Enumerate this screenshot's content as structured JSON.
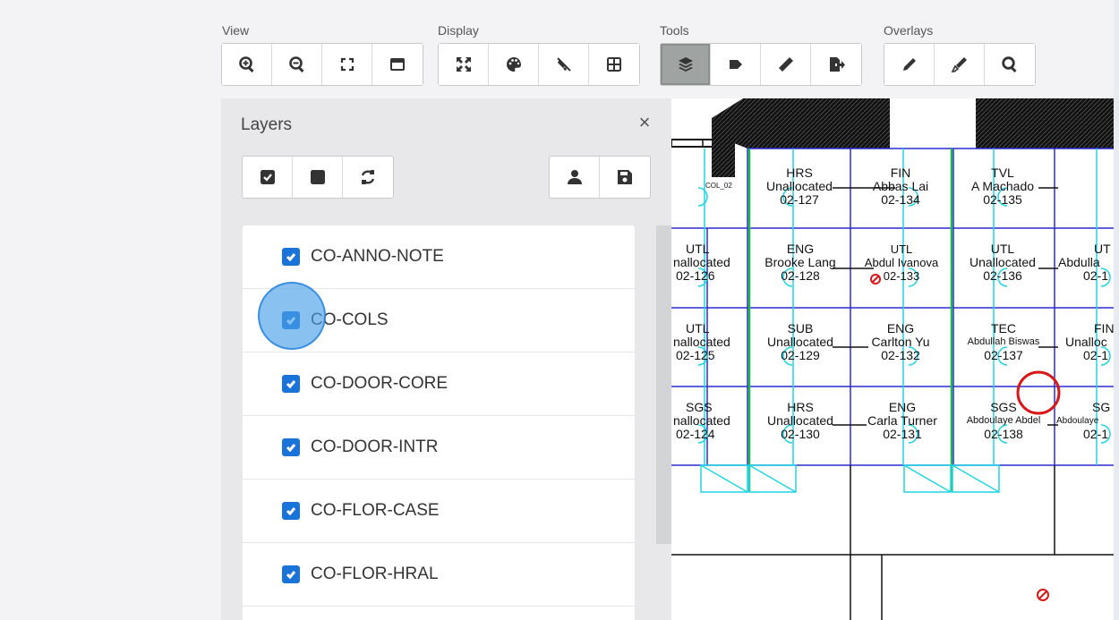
{
  "toolbar": {
    "groups": [
      {
        "label": "View",
        "buttons": [
          "zoom-in-icon",
          "zoom-out-icon",
          "fit-screen-icon",
          "window-icon"
        ]
      },
      {
        "label": "Display",
        "buttons": [
          "expand-icon",
          "palette-icon",
          "hide-icon",
          "grid-icon"
        ]
      },
      {
        "label": "Tools",
        "buttons": [
          "layers-icon",
          "tag-icon",
          "ruler-icon",
          "export-icon"
        ],
        "active": "layers-icon"
      },
      {
        "label": "Overlays",
        "buttons": [
          "pencil-icon",
          "marker-icon",
          "search-icon"
        ]
      }
    ]
  },
  "layers_panel": {
    "title": "Layers",
    "close_label": "×",
    "items": [
      {
        "label": "CO-ANNO-NOTE",
        "checked": true
      },
      {
        "label": "CO-COLS",
        "checked": true
      },
      {
        "label": "CO-DOOR-CORE",
        "checked": true
      },
      {
        "label": "CO-DOOR-INTR",
        "checked": true
      },
      {
        "label": "CO-FLOR-CASE",
        "checked": true
      },
      {
        "label": "CO-FLOR-HRAL",
        "checked": true
      }
    ]
  },
  "floor_plan": {
    "rooms": [
      {
        "dept": "HRS",
        "occupant": "Unallocated",
        "number": "02-127"
      },
      {
        "dept": "FIN",
        "occupant": "Abbas Lai",
        "number": "02-134"
      },
      {
        "dept": "TVL",
        "occupant": "A Machado",
        "number": "02-135"
      },
      {
        "dept": "UTL",
        "occupant": "nallocated",
        "number": "02-126"
      },
      {
        "dept": "ENG",
        "occupant": "Brooke Lang",
        "number": "02-128"
      },
      {
        "dept": "UTL",
        "occupant": "Abdul Ivanova",
        "number": "02-133"
      },
      {
        "dept": "UTL",
        "occupant": "Unallocated",
        "number": "02-136"
      },
      {
        "dept": "UT",
        "occupant": "Abdulla",
        "number": "02-1"
      },
      {
        "dept": "UTL",
        "occupant": "nallocated",
        "number": "02-125"
      },
      {
        "dept": "SUB",
        "occupant": "Unallocated",
        "number": "02-129"
      },
      {
        "dept": "ENG",
        "occupant": "Carlton Yu",
        "number": "02-132"
      },
      {
        "dept": "TEC",
        "occupant": "Abdullah Biswas",
        "number": "02-137"
      },
      {
        "dept": "FIN",
        "occupant": "Unalloc",
        "number": "02-1"
      },
      {
        "dept": "SGS",
        "occupant": "nallocated",
        "number": "02-124"
      },
      {
        "dept": "HRS",
        "occupant": "Unallocated",
        "number": "02-130"
      },
      {
        "dept": "ENG",
        "occupant": "Carla Turner",
        "number": "02-131"
      },
      {
        "dept": "SGS",
        "occupant": "Abdoulaye Abdel",
        "number": "02-138"
      },
      {
        "dept": "SG",
        "occupant": "Abdoulaye",
        "number": "02-1"
      }
    ],
    "small_label": "COL_02"
  }
}
